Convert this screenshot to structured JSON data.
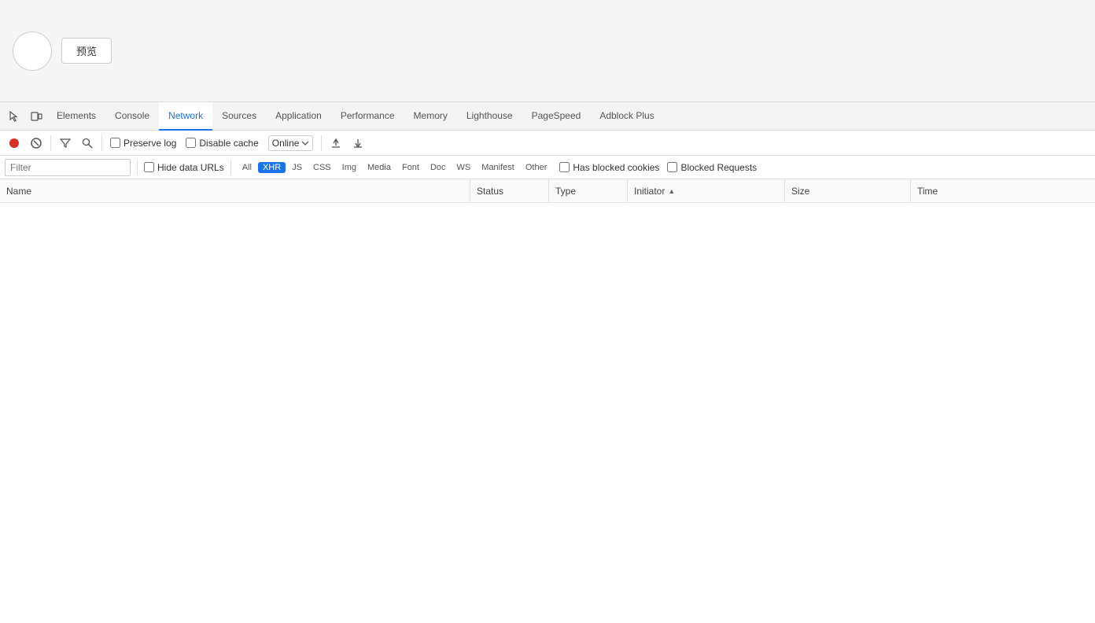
{
  "browser": {
    "preview_btn": "预览"
  },
  "devtools": {
    "tabs": [
      {
        "id": "elements",
        "label": "Elements",
        "active": false
      },
      {
        "id": "console",
        "label": "Console",
        "active": false
      },
      {
        "id": "network",
        "label": "Network",
        "active": true
      },
      {
        "id": "sources",
        "label": "Sources",
        "active": false
      },
      {
        "id": "application",
        "label": "Application",
        "active": false
      },
      {
        "id": "performance",
        "label": "Performance",
        "active": false
      },
      {
        "id": "memory",
        "label": "Memory",
        "active": false
      },
      {
        "id": "lighthouse",
        "label": "Lighthouse",
        "active": false
      },
      {
        "id": "pagespeed",
        "label": "PageSpeed",
        "active": false
      },
      {
        "id": "adblock",
        "label": "Adblock Plus",
        "active": false
      }
    ],
    "toolbar": {
      "preserve_log": "Preserve log",
      "disable_cache": "Disable cache",
      "online_label": "Online"
    },
    "filter": {
      "placeholder": "Filter",
      "hide_data_urls": "Hide data URLs",
      "types": [
        {
          "label": "All",
          "active": false
        },
        {
          "label": "XHR",
          "active": true
        },
        {
          "label": "JS",
          "active": false
        },
        {
          "label": "CSS",
          "active": false
        },
        {
          "label": "Img",
          "active": false
        },
        {
          "label": "Media",
          "active": false
        },
        {
          "label": "Font",
          "active": false
        },
        {
          "label": "Doc",
          "active": false
        },
        {
          "label": "WS",
          "active": false
        },
        {
          "label": "Manifest",
          "active": false
        },
        {
          "label": "Other",
          "active": false
        }
      ],
      "has_blocked_cookies": "Has blocked cookies",
      "blocked_requests": "Blocked Requests"
    },
    "table": {
      "columns": [
        {
          "id": "name",
          "label": "Name"
        },
        {
          "id": "status",
          "label": "Status"
        },
        {
          "id": "type",
          "label": "Type"
        },
        {
          "id": "initiator",
          "label": "Initiator"
        },
        {
          "id": "size",
          "label": "Size"
        },
        {
          "id": "time",
          "label": "Time"
        }
      ]
    }
  }
}
